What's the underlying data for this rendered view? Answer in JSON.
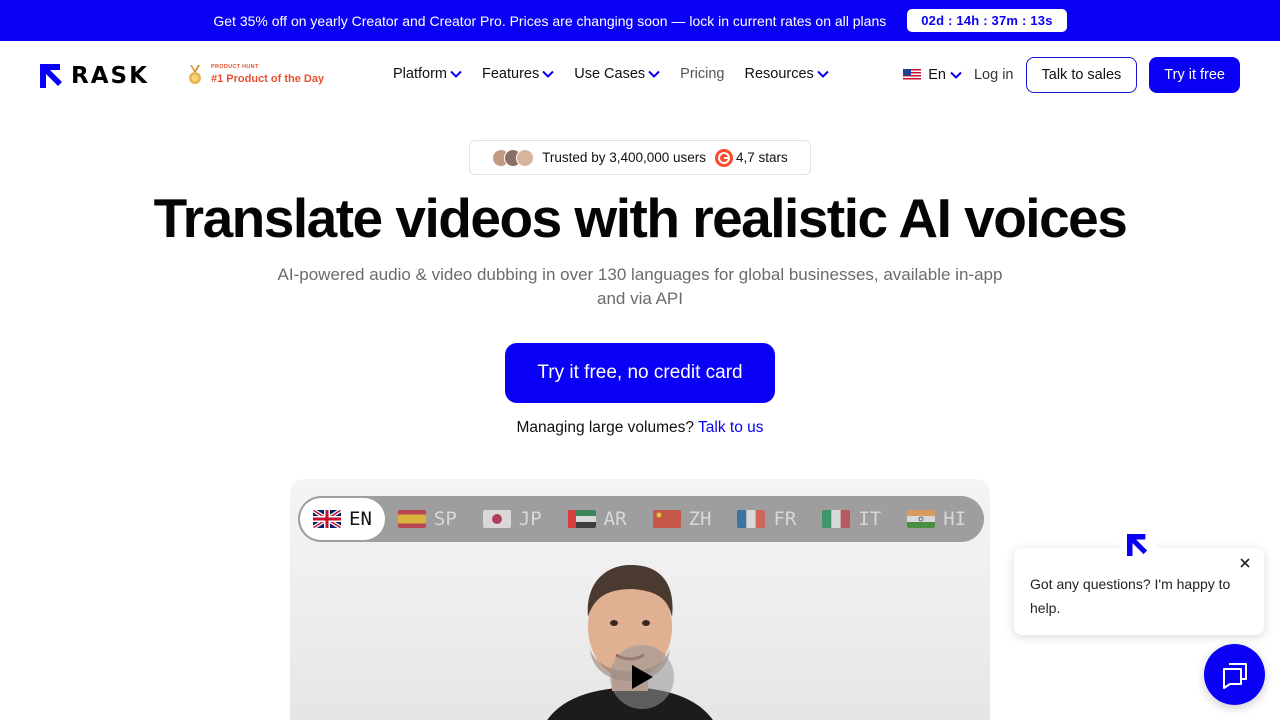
{
  "promo": {
    "text": "Get 35% off on yearly Creator and Creator Pro. Prices are changing soon — lock in current rates on all plans",
    "timer": "02d : 14h : 37m : 13s"
  },
  "brand": {
    "name": "RASK",
    "product_hunt_small": "PRODUCT HUNT",
    "product_hunt_big": "#1 Product of the Day"
  },
  "nav": {
    "items": [
      {
        "label": "Platform",
        "dropdown": true
      },
      {
        "label": "Features",
        "dropdown": true
      },
      {
        "label": "Use Cases",
        "dropdown": true
      },
      {
        "label": "Pricing",
        "dropdown": false
      },
      {
        "label": "Resources",
        "dropdown": true
      }
    ],
    "language": "En",
    "login": "Log in",
    "talk_to_sales": "Talk to sales",
    "try_free": "Try it free"
  },
  "hero": {
    "trusted": "Trusted by 3,400,000 users",
    "stars": "4,7 stars",
    "headline": "Translate videos with realistic AI voices",
    "subheadline": "AI-powered audio & video dubbing in over 130 languages for global businesses, available in-app and via API",
    "cta": "Try it free, no credit card",
    "manage_text": "Managing large volumes?",
    "manage_link": "Talk to us"
  },
  "video": {
    "languages": [
      {
        "code": "EN",
        "flag": "uk-flag-icon",
        "active": true
      },
      {
        "code": "SP",
        "flag": "spain-flag-icon",
        "active": false
      },
      {
        "code": "JP",
        "flag": "japan-flag-icon",
        "active": false
      },
      {
        "code": "AR",
        "flag": "uae-flag-icon",
        "active": false
      },
      {
        "code": "ZH",
        "flag": "china-flag-icon",
        "active": false
      },
      {
        "code": "FR",
        "flag": "france-flag-icon",
        "active": false
      },
      {
        "code": "IT",
        "flag": "italy-flag-icon",
        "active": false
      },
      {
        "code": "HI",
        "flag": "india-flag-icon",
        "active": false
      }
    ]
  },
  "chat": {
    "message": "Got any questions? I'm happy to help."
  },
  "colors": {
    "brand_blue": "#0a00f5",
    "product_hunt": "#e8502e"
  }
}
